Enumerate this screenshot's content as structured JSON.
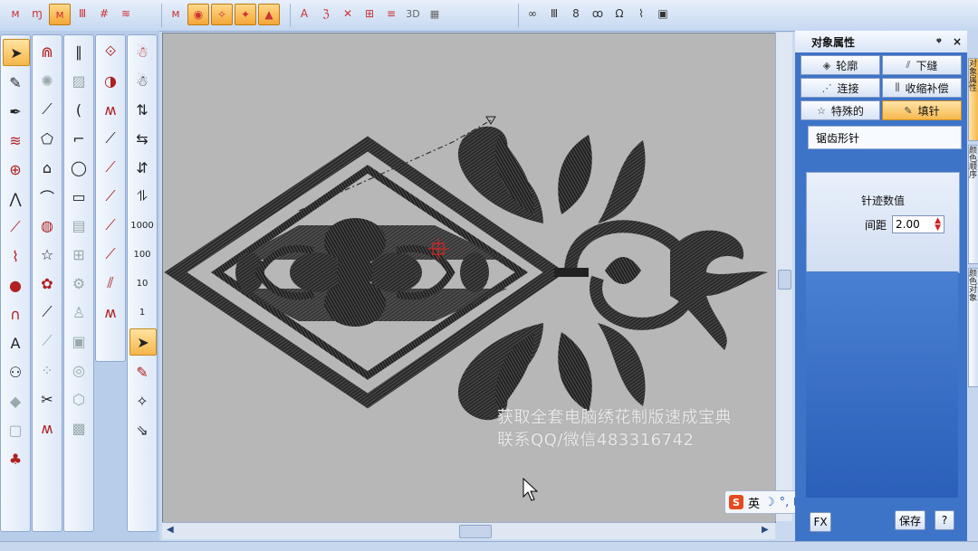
{
  "toolbar": {
    "groups": [
      {
        "icons": [
          "stitch-fill-icon",
          "stitch-run-icon",
          "stitch-satin-icon",
          "stitch-tatami-icon",
          "stitch-cross-icon",
          "stitch-wave-icon"
        ],
        "active": 2
      },
      {
        "icons": [
          "fill-a-icon",
          "fill-b-icon",
          "fill-c-icon",
          "fill-d-icon",
          "fill-e-icon"
        ],
        "active": -1
      },
      {
        "icons": [
          "letter-a-icon",
          "zigzag-icon",
          "hatch-icon",
          "grid-icon",
          "lines-icon",
          "pattern-icon"
        ],
        "labels": [
          "",
          "",
          "",
          "",
          "",
          "3D"
        ]
      },
      {
        "icons": [
          "chain-icon",
          "column-icon",
          "link-icon",
          "loop-icon",
          "omega-icon",
          "split-icon",
          "monitor-icon"
        ]
      }
    ]
  },
  "properties": {
    "title": "对象属性",
    "pin": "ᵠ",
    "close": "×",
    "tabs": [
      {
        "label": "轮廓",
        "icon": "outline-icon"
      },
      {
        "label": "下缝",
        "icon": "underlay-icon"
      },
      {
        "label": "连接",
        "icon": "connect-icon"
      },
      {
        "label": "收缩补偿",
        "icon": "compensation-icon"
      },
      {
        "label": "特殊的",
        "icon": "star-icon"
      },
      {
        "label": "填针",
        "icon": "fill-stitch-icon"
      }
    ],
    "fill_type": "锯齿形针",
    "panel_title": "针迹数值",
    "spacing_label": "间距",
    "spacing_value": "2.00",
    "buttons": {
      "fx": "FX",
      "save": "保存",
      "help": "?"
    }
  },
  "side_tabs": [
    "对象属性",
    "颜色顺序",
    "颜色对象"
  ],
  "watermark": {
    "line1": "获取全套电脑绣花制版速成宝典",
    "line2": "联系QQ/微信483316742"
  },
  "ime": {
    "logo": "S",
    "lang": "英"
  },
  "left_numbers": [
    "1000",
    "100",
    "10",
    "1"
  ]
}
